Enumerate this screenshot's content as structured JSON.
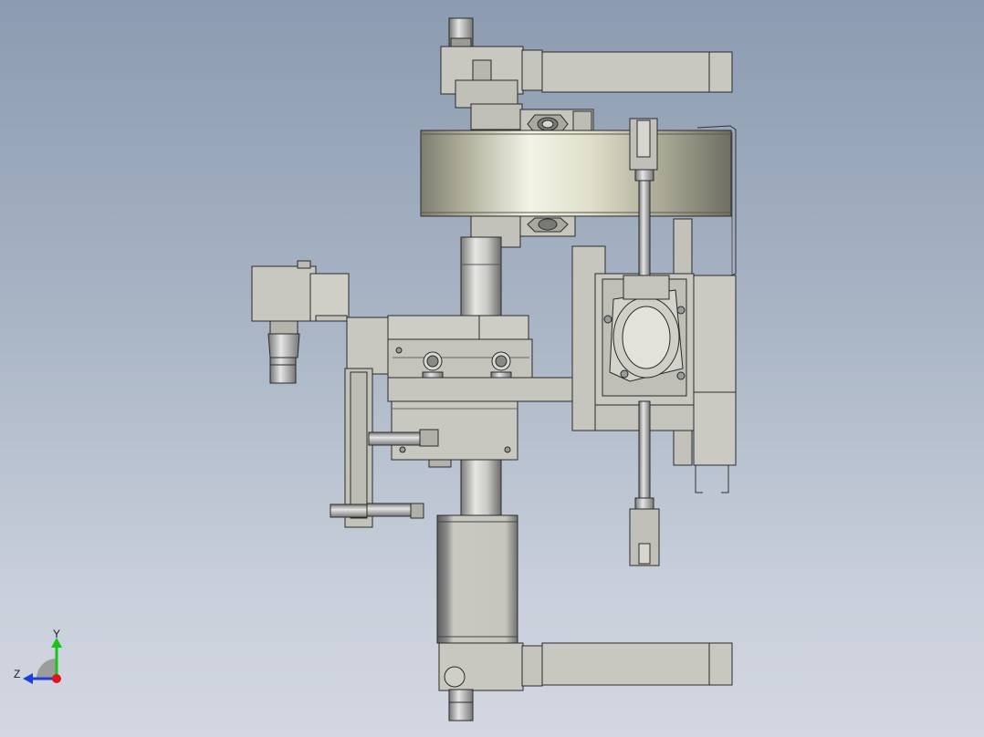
{
  "viewport": {
    "background_top": "#8c9bb1",
    "background_bottom": "#d3d7e1"
  },
  "triad": {
    "y_label": "Y",
    "z_label": "Z",
    "y_color": "#19c419",
    "z_color": "#1f3fd9",
    "x_color": "#e0141e"
  },
  "model": {
    "part_color": "#c8c8c0",
    "edge_color": "#2a2a2a",
    "shaft_color": "#b9b9b9",
    "motor_dark": "#6f6f6f",
    "ring_highlight": "#f3f3e6"
  }
}
